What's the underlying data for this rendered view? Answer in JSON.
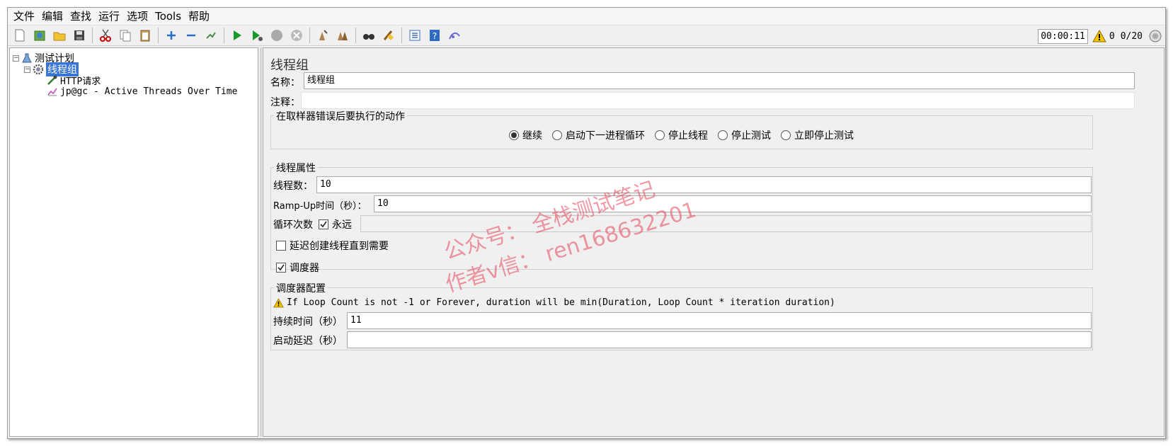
{
  "menu": [
    "文件",
    "编辑",
    "查找",
    "运行",
    "选项",
    "Tools",
    "帮助"
  ],
  "toolbar": {
    "icons": [
      "new-icon",
      "templates-icon",
      "open-icon",
      "save-icon",
      "cut-icon",
      "copy-icon",
      "paste-icon",
      "expand-icon",
      "collapse-icon",
      "toggle-icon",
      "start-icon",
      "start-no-pause-icon",
      "stop-icon",
      "shutdown-icon",
      "clear-icon",
      "clear-all-icon",
      "search-icon",
      "reset-search-icon",
      "function-helper-icon",
      "help-icon",
      "remote-icon"
    ],
    "timer": "00:00:11",
    "warn_count": "0",
    "threads": "0/20"
  },
  "tree": {
    "root": "测试计划",
    "thread_group": "线程组",
    "http": "HTTP请求",
    "listener": "jp@gc - Active Threads Over Time"
  },
  "panel": {
    "title": "线程组",
    "name_label": "名称：",
    "name_value": "线程组",
    "comment_label": "注释：",
    "comment_value": "",
    "error_section": "在取样器错误后要执行的动作",
    "error_options": [
      "继续",
      "启动下一进程循环",
      "停止线程",
      "停止测试",
      "立即停止测试"
    ],
    "error_selected": 0,
    "thread_section": "线程属性",
    "threads_label": "线程数：",
    "threads_value": "10",
    "rampup_label": "Ramp-Up时间（秒）：",
    "rampup_value": "10",
    "loop_label": "循环次数",
    "forever_label": "永远",
    "loop_value": "",
    "delay_label": "延迟创建线程直到需要",
    "scheduler_label": "调度器",
    "sched_section": "调度器配置",
    "sched_warning": "If Loop Count is not -1 or Forever, duration will be min(Duration, Loop Count * iteration duration)",
    "duration_label": "持续时间（秒）",
    "duration_value": "11",
    "startup_label": "启动延迟（秒）",
    "startup_value": ""
  },
  "watermark": {
    "line1": "公众号： 全栈测试笔记",
    "line2": "作者v信： ren168632201"
  }
}
